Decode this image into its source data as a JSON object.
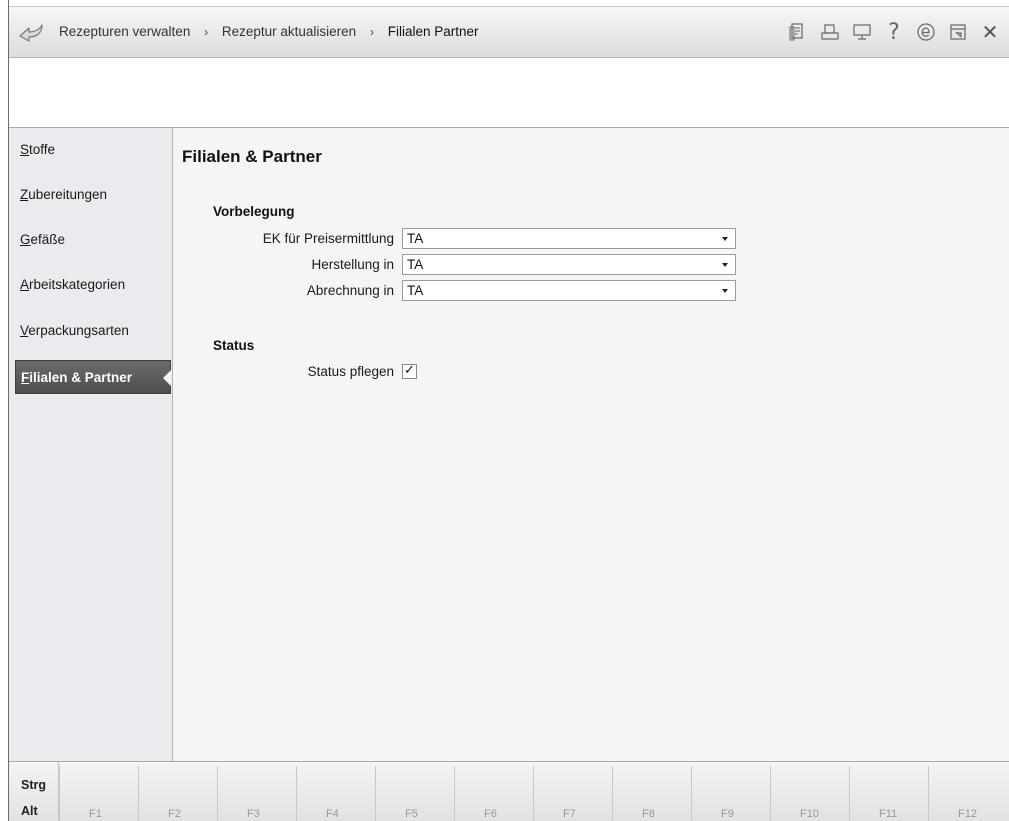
{
  "header": {
    "breadcrumb": [
      "Rezepturen verwalten",
      "Rezeptur aktualisieren",
      "Filialen  Partner"
    ],
    "separator": "›",
    "icons": [
      "document-icon",
      "print-icon",
      "monitor-icon",
      "help-icon",
      "e-icon",
      "window-icon",
      "close-icon"
    ],
    "help_glyph": "?",
    "close_glyph": "✕"
  },
  "sidebar": {
    "items": [
      {
        "mnemonic": "S",
        "rest": "toffe"
      },
      {
        "mnemonic": "Z",
        "rest": "ubereitungen"
      },
      {
        "mnemonic": "G",
        "rest": "efäße"
      },
      {
        "mnemonic": "A",
        "rest": "rbeitskategorien"
      },
      {
        "mnemonic": "V",
        "rest": "erpackungsarten"
      },
      {
        "mnemonic": "F",
        "rest": "ilialen & Partner"
      }
    ],
    "active_index": 5
  },
  "main": {
    "title": "Filialen & Partner",
    "vorbelegung": {
      "title": "Vorbelegung",
      "fields": [
        {
          "label": "EK für Preisermittlung",
          "value": "TA"
        },
        {
          "label": "Herstellung in",
          "value": "TA"
        },
        {
          "label": "Abrechnung in",
          "value": "TA"
        }
      ]
    },
    "status": {
      "title": "Status",
      "checkbox_label": "Status pflegen",
      "checked": true,
      "check_glyph": "✓"
    }
  },
  "fkeys": {
    "modifiers": [
      "Strg",
      "Alt"
    ],
    "keys": [
      "F1",
      "F2",
      "F3",
      "F4",
      "F5",
      "F6",
      "F7",
      "F8",
      "F9",
      "F10",
      "F11",
      "F12"
    ]
  },
  "colors": {
    "active_nav": "#555555",
    "sidebar_bg": "#e9ebee",
    "content_bg": "#f5f5f5"
  }
}
